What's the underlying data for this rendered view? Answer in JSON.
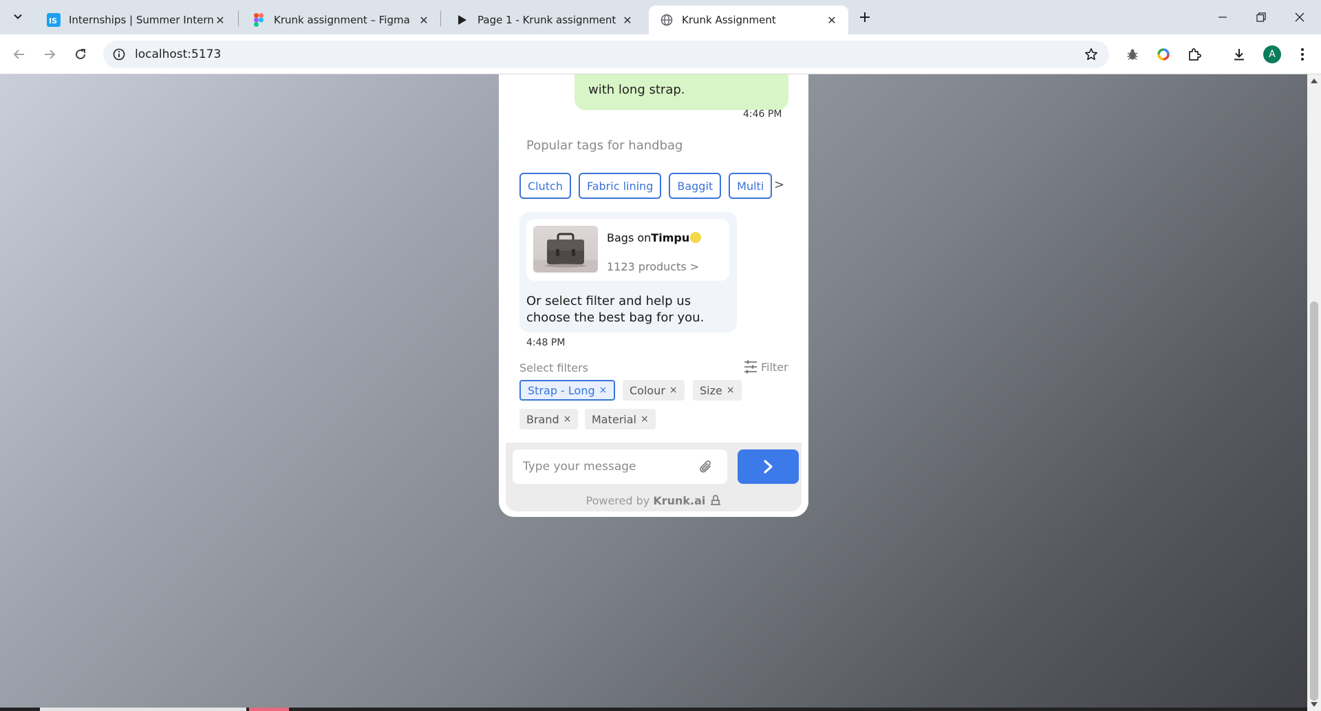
{
  "browser": {
    "tabs": [
      {
        "title": "Internships | Summer Internship",
        "favicon": "internshala-icon"
      },
      {
        "title": "Krunk assignment – Figma",
        "favicon": "figma-icon"
      },
      {
        "title": "Page 1 - Krunk assignment",
        "favicon": "play-icon"
      },
      {
        "title": "Krunk Assignment",
        "favicon": "globe-icon",
        "active": true
      }
    ],
    "url": "localhost:5173",
    "profile_initial": "A",
    "colors": {
      "tabstrip": "#dde3ea",
      "omnibox": "#eff2f7",
      "profile": "#0b7d5a"
    }
  },
  "chat": {
    "user_message_tail": "with long strap.",
    "user_time": "4:46 PM",
    "popular_title": "Popular tags for handbag",
    "tags": [
      "Clutch",
      "Fabric lining",
      "Baggit",
      "Multi"
    ],
    "tags_next": ">",
    "store": {
      "prefix": "Bags on",
      "brand": "Timpu",
      "products": "1123 products",
      "chevron": ">"
    },
    "bot_text": "Or select filter and help us choose the best bag for you.",
    "bot_time": "4:48 PM",
    "filters_title": "Select filters",
    "filter_button": "Filter",
    "filters": [
      {
        "label": "Strap - Long",
        "active": true
      },
      {
        "label": "Colour",
        "active": false
      },
      {
        "label": "Size",
        "active": false
      },
      {
        "label": "Brand",
        "active": false
      },
      {
        "label": "Material",
        "active": false
      }
    ],
    "remove_symbol": "×",
    "input_placeholder": "Type your message",
    "powered_prefix": "Powered by",
    "powered_brand": "Krunk.ai",
    "colors": {
      "accent": "#3b73d8",
      "send": "#3b7ae8",
      "user_bubble": "#d8f5c7",
      "bot_bubble": "#f1f4fb"
    }
  }
}
